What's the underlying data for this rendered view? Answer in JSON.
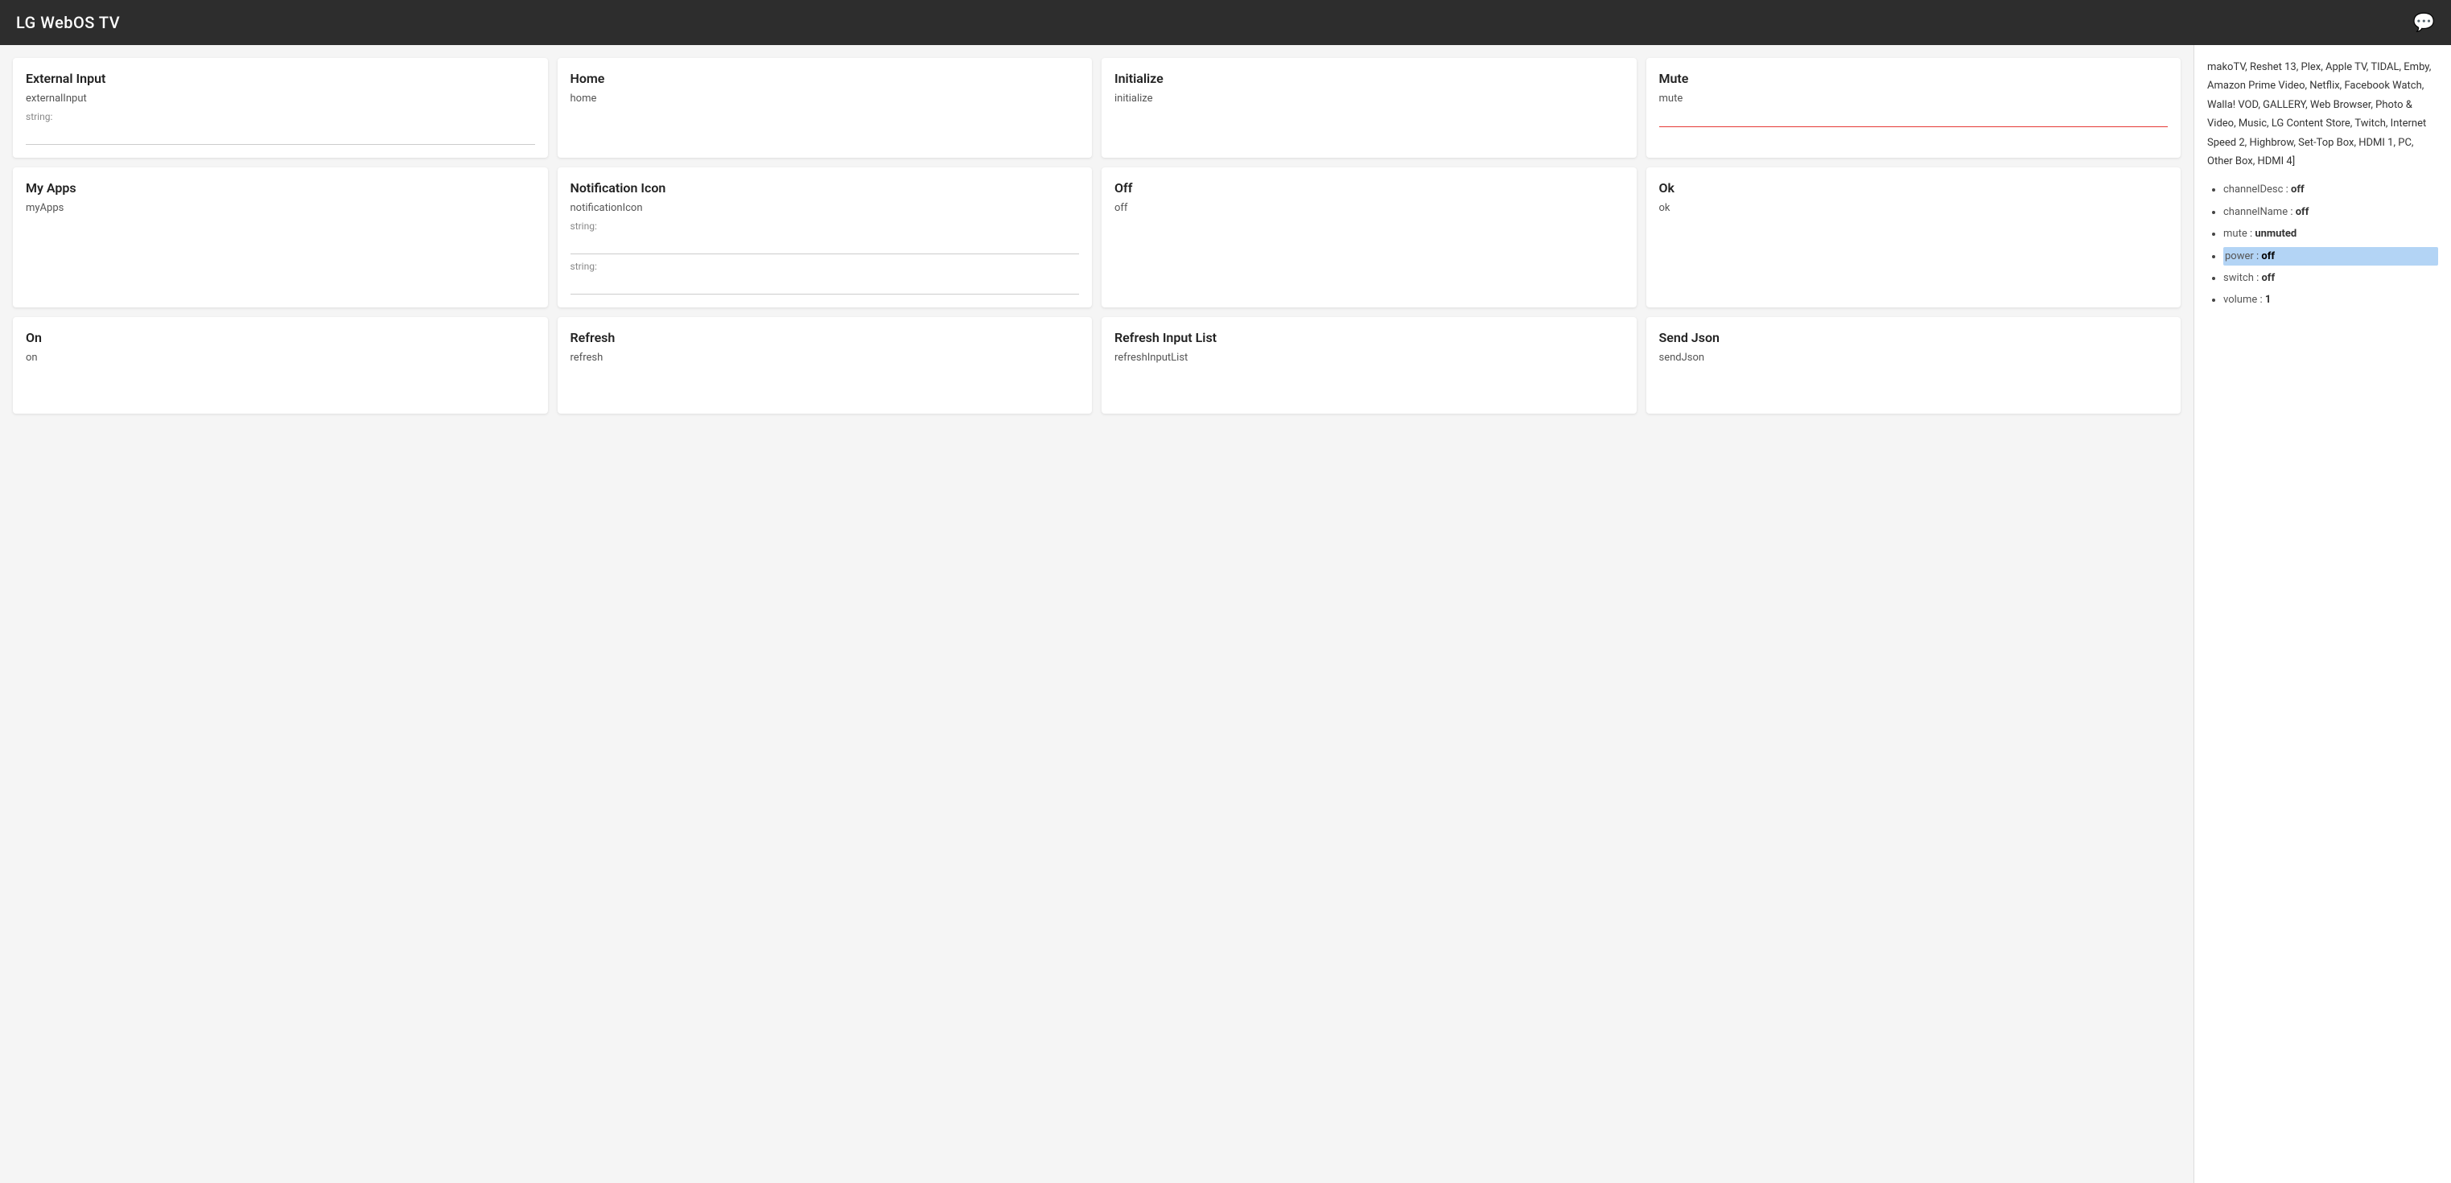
{
  "header": {
    "title": "LG WebOS TV",
    "chat_icon": "💬"
  },
  "sidebar": {
    "apps_text": "makoTV, Reshet 13, Plex, Apple TV, TIDAL, Emby, Amazon Prime Video, Netflix, Facebook Watch, Walla! VOD, GALLERY, Web Browser, Photo & Video, Music, LG Content Store, Twitch, Internet Speed 2, Highbrow, Set-Top Box, HDMI 1, PC, Other Box, HDMI 4]",
    "properties": [
      {
        "key": "channelDesc",
        "value": "off",
        "highlighted": false
      },
      {
        "key": "channelName",
        "value": "off",
        "highlighted": false
      },
      {
        "key": "mute",
        "value": "unmuted",
        "highlighted": false
      },
      {
        "key": "power",
        "value": "off",
        "highlighted": true
      },
      {
        "key": "switch",
        "value": "off",
        "highlighted": false
      },
      {
        "key": "volume",
        "value": "1",
        "highlighted": false
      }
    ]
  },
  "rows": [
    {
      "cards": [
        {
          "id": "external-input",
          "title": "External Input",
          "subtitle": "externalInput",
          "label": "string:",
          "has_input": true,
          "input_value": "",
          "red_underline": false
        },
        {
          "id": "home",
          "title": "Home",
          "subtitle": "home",
          "label": "",
          "has_input": false,
          "input_value": "",
          "red_underline": false
        },
        {
          "id": "initialize",
          "title": "Initialize",
          "subtitle": "initialize",
          "label": "",
          "has_input": false,
          "input_value": "",
          "red_underline": false
        },
        {
          "id": "mute",
          "title": "Mute",
          "subtitle": "mute",
          "label": "",
          "has_input": false,
          "input_value": "",
          "red_underline": true
        }
      ]
    },
    {
      "cards": [
        {
          "id": "my-apps",
          "title": "My Apps",
          "subtitle": "myApps",
          "label": "",
          "has_input": false,
          "input_value": "",
          "red_underline": false
        },
        {
          "id": "notification-icon",
          "title": "Notification Icon",
          "subtitle": "notificationIcon",
          "label": "string:",
          "has_input": true,
          "input_value": "",
          "label2": "string:",
          "has_input2": true,
          "input_value2": "",
          "red_underline": false
        },
        {
          "id": "off",
          "title": "Off",
          "subtitle": "off",
          "label": "",
          "has_input": false,
          "input_value": "",
          "red_underline": false
        },
        {
          "id": "ok",
          "title": "Ok",
          "subtitle": "ok",
          "label": "",
          "has_input": false,
          "input_value": "",
          "red_underline": false
        }
      ]
    },
    {
      "cards": [
        {
          "id": "on",
          "title": "On",
          "subtitle": "on",
          "label": "",
          "has_input": false,
          "input_value": "",
          "red_underline": false
        },
        {
          "id": "refresh",
          "title": "Refresh",
          "subtitle": "refresh",
          "label": "",
          "has_input": false,
          "input_value": "",
          "red_underline": false
        },
        {
          "id": "refresh-input-list",
          "title": "Refresh Input List",
          "subtitle": "refreshInputList",
          "label": "",
          "has_input": false,
          "input_value": "",
          "red_underline": false
        },
        {
          "id": "send-json",
          "title": "Send Json",
          "subtitle": "sendJson",
          "label": "",
          "has_input": false,
          "input_value": "",
          "red_underline": false
        }
      ]
    }
  ]
}
